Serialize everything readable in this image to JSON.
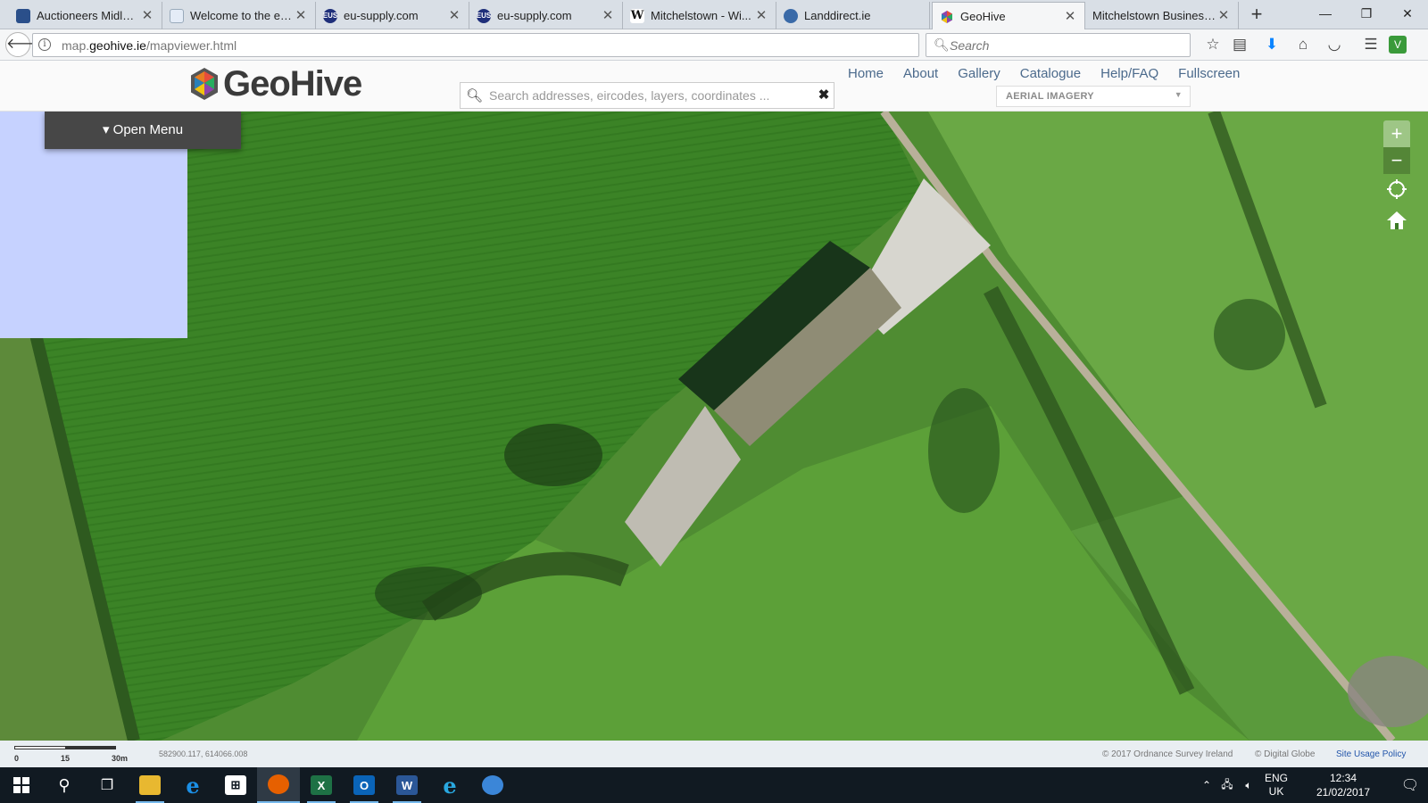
{
  "browser": {
    "tabs": [
      {
        "title": "Auctioneers Midlet...",
        "favicon_color": "#2a4f8a"
      },
      {
        "title": "Welcome to the eT...",
        "favicon_color": "#c8d8ee"
      },
      {
        "title": "eu-supply.com",
        "favicon_color": "#1f2f7a",
        "favicon_text": "EUS"
      },
      {
        "title": "eu-supply.com",
        "favicon_color": "#1f2f7a",
        "favicon_text": "EUS"
      },
      {
        "title": "Mitchelstown - Wi...",
        "favicon_color": "#ffffff",
        "favicon_text": "W"
      },
      {
        "title": "Landdirect.ie",
        "favicon_color": "#3a6aa8"
      },
      {
        "title": "GeoHive",
        "favicon_color": "#9b59b6",
        "active": true
      },
      {
        "title": "Mitchelstown Business...",
        "favicon_color": "#ffffff"
      }
    ],
    "url_prefix": "map.",
    "url_domain": "geohive.ie",
    "url_path": "/mapviewer.html",
    "search_placeholder": "Search"
  },
  "geohive": {
    "logo_text": "GeoHive",
    "search_placeholder": "Search addresses, eircodes, layers, coordinates ...",
    "nav": [
      "Home",
      "About",
      "Gallery",
      "Catalogue",
      "Help/FAQ",
      "Fullscreen"
    ],
    "layer_select": "AERIAL IMAGERY",
    "open_menu": "Open Menu",
    "link_color": "#4b6a8c"
  },
  "map_footer": {
    "scale_labels": [
      "0",
      "15",
      "30m"
    ],
    "coordinates": "582900.117, 614066.008",
    "copyright_osi": "© 2017 Ordnance Survey Ireland",
    "copyright_dg": "© Digital Globe",
    "usage_policy": "Site Usage Policy"
  },
  "taskbar": {
    "language_line1": "ENG",
    "language_line2": "UK",
    "time": "12:34",
    "date": "21/02/2017",
    "accent": "#76b9ed"
  }
}
